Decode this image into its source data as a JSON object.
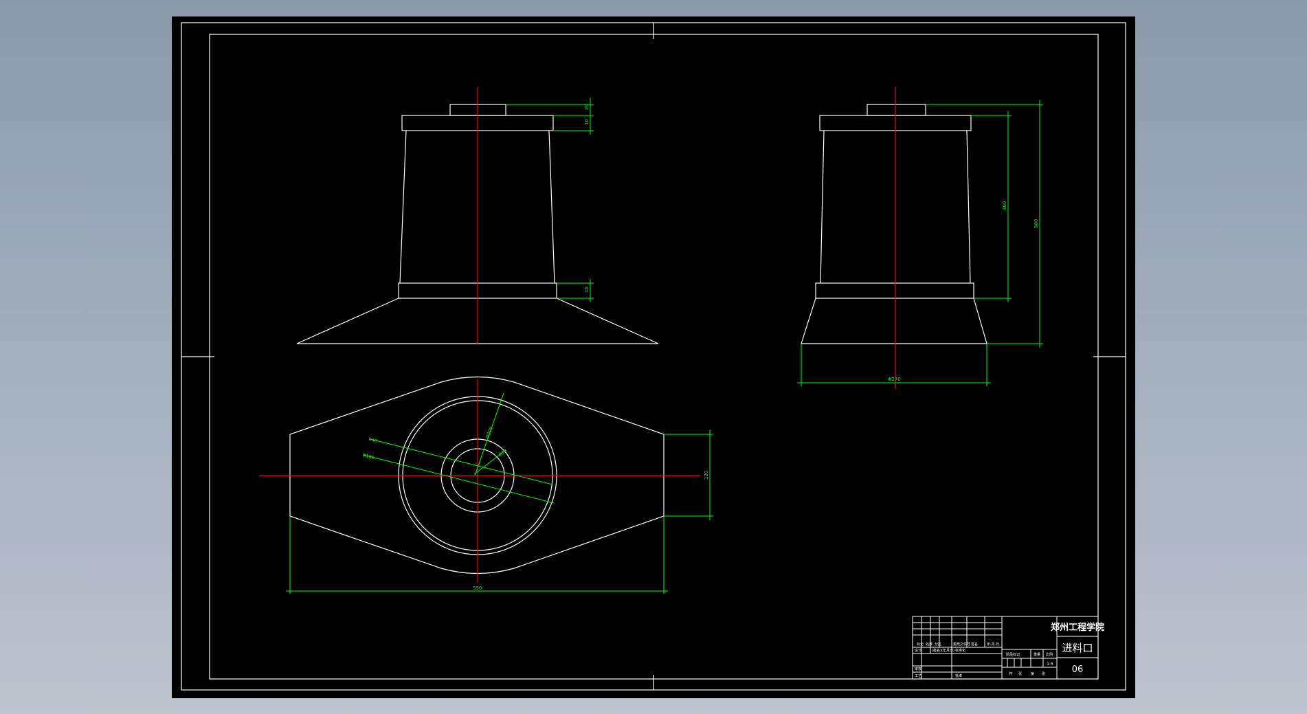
{
  "title_block": {
    "school": "郑州工程学院",
    "part_name": "进料口",
    "drawing_number": "06",
    "scale": "1:5",
    "row_labels": [
      "标记",
      "处数",
      "分区",
      "更改文件号",
      "签名",
      "年.月.日"
    ],
    "row2_labels": [
      "设计",
      "(签名)",
      "(年月日)",
      "标准化"
    ],
    "row3_label": "审核",
    "row4_labels": [
      "工艺",
      "批准"
    ],
    "mid_labels": [
      "阶段标记",
      "重量",
      "比例"
    ],
    "mid_bottom_labels": [
      "共",
      "张",
      "第",
      "张"
    ]
  },
  "dimensions": {
    "front_top_1": "20",
    "front_top_2": "10",
    "front_bottom_flange": "10",
    "side_inner_height": "400",
    "side_total_height": "500",
    "side_bottom_width": "Φ270",
    "plan_r1": "R40",
    "plan_r2": "Φ100",
    "plan_r3": "R70",
    "plan_r4": "Φ200",
    "plan_right_height": "120",
    "plan_bottom_width": "550"
  },
  "colors": {
    "background": "#000000",
    "outline": "#ffffff",
    "centerline": "#ff0000",
    "dimension": "#00ff00"
  }
}
